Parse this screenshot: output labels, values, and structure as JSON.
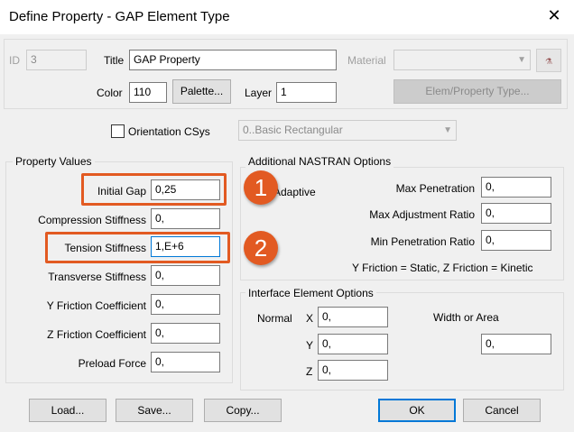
{
  "window": {
    "title": "Define Property - GAP Element Type",
    "close_glyph": "✕"
  },
  "header": {
    "id_label": "ID",
    "id_value": "3",
    "title_label": "Title",
    "title_value": "GAP Property",
    "material_label": "Material",
    "material_value": "",
    "color_label": "Color",
    "color_value": "110",
    "palette_button": "Palette...",
    "layer_label": "Layer",
    "layer_value": "1",
    "elem_property_type_button": "Elem/Property Type..."
  },
  "orientation": {
    "label": "Orientation CSys",
    "checked": false,
    "value": "0..Basic Rectangular"
  },
  "property_values": {
    "group_title": "Property Values",
    "fields": [
      {
        "label": "Initial Gap",
        "value": "0,25"
      },
      {
        "label": "Compression Stiffness",
        "value": "0,"
      },
      {
        "label": "Tension Stiffness",
        "value": "1,E+6"
      },
      {
        "label": "Transverse Stiffness",
        "value": "0,"
      },
      {
        "label": "Y Friction Coefficient",
        "value": "0,"
      },
      {
        "label": "Z Friction Coefficient",
        "value": "0,"
      },
      {
        "label": "Preload Force",
        "value": "0,"
      }
    ]
  },
  "nastran": {
    "group_title": "Additional NASTRAN Options",
    "adaptive_label": "Adaptive",
    "fields": [
      {
        "label": "Max Penetration",
        "value": "0,"
      },
      {
        "label": "Max Adjustment Ratio",
        "value": "0,"
      },
      {
        "label": "Min Penetration Ratio",
        "value": "0,"
      }
    ],
    "friction_note": "Y Friction = Static, Z Friction = Kinetic"
  },
  "interface": {
    "group_title": "Interface Element Options",
    "normal_label": "Normal",
    "x_label": "X",
    "x_value": "0,",
    "y_label": "Y",
    "y_value": "0,",
    "z_label": "Z",
    "z_value": "0,",
    "width_area_label": "Width or Area",
    "width_area_value": "0,"
  },
  "annotations": {
    "badge1": "1",
    "badge2": "2",
    "color": "#e25a22"
  },
  "footer": {
    "load": "Load...",
    "save": "Save...",
    "copy": "Copy...",
    "ok": "OK",
    "cancel": "Cancel"
  },
  "icons": {
    "material_icon": "material-palette-icon",
    "combo_arrow": "chevron-down-icon"
  },
  "accent_color": "#0078d7"
}
